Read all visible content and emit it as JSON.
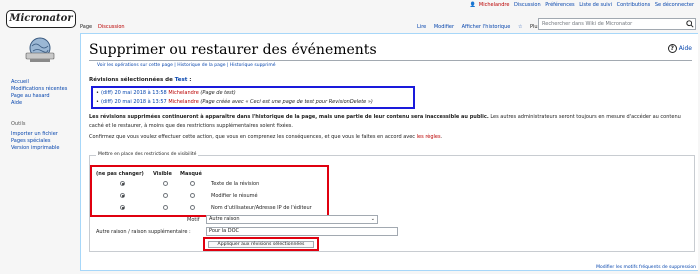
{
  "sidebar": {
    "logo_text": "Micronator",
    "nav": [
      "Accueil",
      "Modifications récentes",
      "Page au hasard",
      "Aide"
    ],
    "tools_heading": "Outils",
    "tools": [
      "Importer un fichier",
      "Pages spéciales",
      "Version imprimable"
    ]
  },
  "personal": {
    "user": "Michelandre",
    "items": [
      "Discussion",
      "Préférences",
      "Liste de suivi",
      "Contributions",
      "Se déconnecter"
    ]
  },
  "tabs": {
    "page": "Page",
    "discussion": "Discussion",
    "right": [
      "Lire",
      "Modifier",
      "Afficher l'historique"
    ],
    "more": "Plus ⌄"
  },
  "search": {
    "placeholder": "Rechercher dans Wiki de Micronator"
  },
  "content": {
    "title": "Supprimer ou restaurer des événements",
    "help": "Aide",
    "subtitle": "Voir les opérations sur cette page | Historique de la page | Historique supprimé",
    "revisions_heading_prefix": "Révisions sélectionnées de",
    "revisions_heading_link": "Test",
    "revisions_heading_suffix": " :",
    "revisions": [
      {
        "diff": "(diff)",
        "date": "20 mai 2018 à 13:58",
        "user": "Michelandre",
        "summary": "(Page de test)"
      },
      {
        "diff": "(diff)",
        "date": "20 mai 2018 à 13:57",
        "user": "Michelandre",
        "summary": "(Page créée avec « Ceci est une page de test pour RevisionDelete »)"
      }
    ],
    "warning_bold": "Les révisions supprimées continueront à apparaître dans l'historique de la page, mais une partie de leur contenu sera inaccessible au public.",
    "warning_rest": " Les autres administrateurs seront toujours en mesure d'accéder au contenu caché et le restaurer, à moins que des restrictions supplémentaires soient fixées.",
    "confirm_text": "Confirmez que vous voulez effectuer cette action, que vous en comprenez les conséquences, et que vous le faites en accord avec ",
    "confirm_link": "les règles",
    "confirm_end": "."
  },
  "visibility": {
    "legend": "Mettre en place des restrictions de visibilité",
    "headers": [
      "(ne pas changer)",
      "Visible",
      "Masqué"
    ],
    "rows": [
      {
        "label": "Texte de la révision",
        "selected": 0
      },
      {
        "label": "Modifier le résumé",
        "selected": 0
      },
      {
        "label": "Nom d'utilisateur/Adresse IP de l'éditeur",
        "selected": 0
      }
    ],
    "motif_label": "Motif",
    "motif_value": "Autre raison",
    "reason_label": "Autre raison / raison supplémentaire :",
    "reason_value": "Pour la DOC",
    "apply_label": "Appliquer aux révisions sélectionnées"
  },
  "footer": {
    "link": "Modifier les motifs fréquents de suppression"
  },
  "colors": {
    "link": "#0645ad",
    "redlink": "#ba0000",
    "blue_box": "#1a1adb",
    "red_box": "#e0000f"
  }
}
